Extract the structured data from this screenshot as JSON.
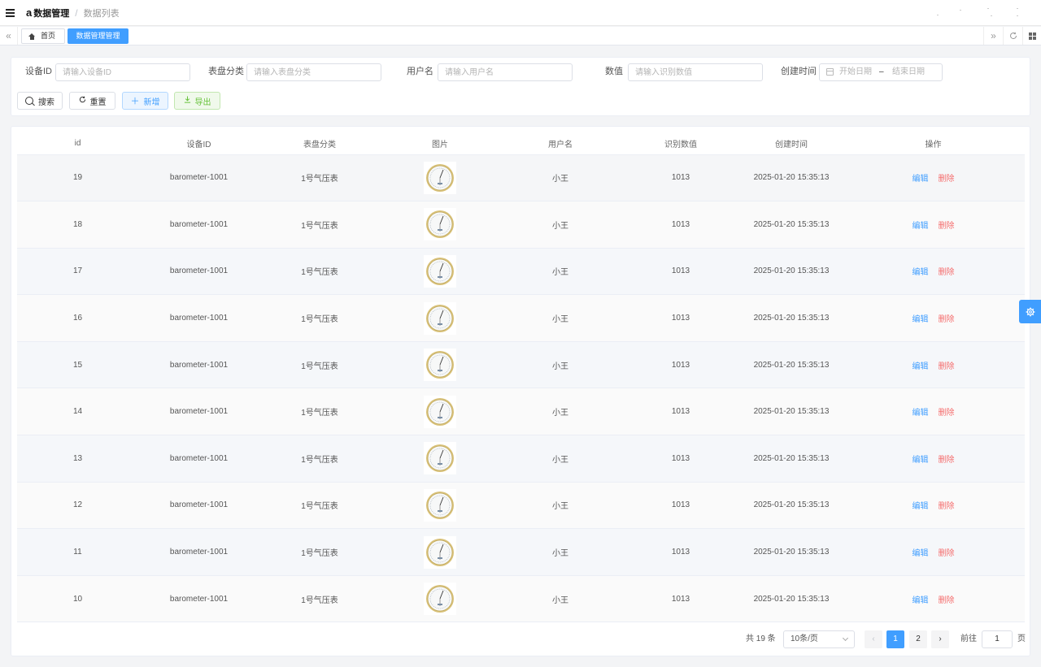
{
  "header": {
    "logo_glyph": "a",
    "app_title": "数据管理",
    "breadcrumb_separator": "/",
    "breadcrumb_current": "数据列表"
  },
  "tags": {
    "home_label": "首页",
    "active_label": "数据管理管理"
  },
  "search": {
    "device_id_label": "设备ID",
    "device_id_placeholder": "请输入设备ID",
    "category_label": "表盘分类",
    "category_placeholder": "请输入表盘分类",
    "username_label": "用户名",
    "username_placeholder": "请输入用户名",
    "value_label": "数值",
    "value_placeholder": "请输入识别数值",
    "created_label": "创建时间",
    "start_placeholder": "开始日期",
    "range_separator": "–",
    "end_placeholder": "结束日期",
    "search_btn": "搜索",
    "reset_btn": "重置",
    "add_btn": "新增",
    "export_btn": "导出"
  },
  "table": {
    "columns": [
      "id",
      "设备ID",
      "表盘分类",
      "图片",
      "用户名",
      "识别数值",
      "创建时间",
      "操作"
    ],
    "edit_label": "编辑",
    "delete_label": "删除",
    "rows": [
      {
        "id": "19",
        "device": "barometer-1001",
        "category": "1号气压表",
        "user": "小王",
        "value": "1013",
        "created": "2025-01-20 15:35:13"
      },
      {
        "id": "18",
        "device": "barometer-1001",
        "category": "1号气压表",
        "user": "小王",
        "value": "1013",
        "created": "2025-01-20 15:35:13"
      },
      {
        "id": "17",
        "device": "barometer-1001",
        "category": "1号气压表",
        "user": "小王",
        "value": "1013",
        "created": "2025-01-20 15:35:13"
      },
      {
        "id": "16",
        "device": "barometer-1001",
        "category": "1号气压表",
        "user": "小王",
        "value": "1013",
        "created": "2025-01-20 15:35:13"
      },
      {
        "id": "15",
        "device": "barometer-1001",
        "category": "1号气压表",
        "user": "小王",
        "value": "1013",
        "created": "2025-01-20 15:35:13"
      },
      {
        "id": "14",
        "device": "barometer-1001",
        "category": "1号气压表",
        "user": "小王",
        "value": "1013",
        "created": "2025-01-20 15:35:13"
      },
      {
        "id": "13",
        "device": "barometer-1001",
        "category": "1号气压表",
        "user": "小王",
        "value": "1013",
        "created": "2025-01-20 15:35:13"
      },
      {
        "id": "12",
        "device": "barometer-1001",
        "category": "1号气压表",
        "user": "小王",
        "value": "1013",
        "created": "2025-01-20 15:35:13"
      },
      {
        "id": "11",
        "device": "barometer-1001",
        "category": "1号气压表",
        "user": "小王",
        "value": "1013",
        "created": "2025-01-20 15:35:13"
      },
      {
        "id": "10",
        "device": "barometer-1001",
        "category": "1号气压表",
        "user": "小王",
        "value": "1013",
        "created": "2025-01-20 15:35:13"
      }
    ]
  },
  "pagination": {
    "total_text": "共 19 条",
    "page_size": "10条/页",
    "prev": "‹",
    "pages": [
      "1",
      "2"
    ],
    "current_page": "1",
    "next": "›",
    "goto_label": "前往",
    "goto_value": "1",
    "page_suffix": "页"
  },
  "colors": {
    "primary": "#409eff",
    "danger": "#f56c6c",
    "success": "#67c23a"
  },
  "icons": {
    "menu": "hamburger-icon",
    "home": "home-icon",
    "settings": "gear-icon"
  }
}
